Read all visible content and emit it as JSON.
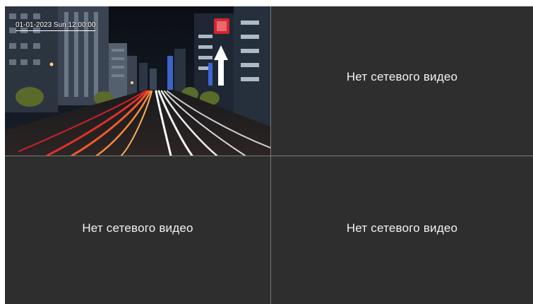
{
  "channel1": {
    "timestamp": "01-01-2023 Sun 12:00:00",
    "feed_icon": "night-city-traffic-camera-feed"
  },
  "channel2": {
    "message": "Нет сетевого видео"
  },
  "channel3": {
    "message": "Нет сетевого видео"
  },
  "channel4": {
    "message": "Нет сетевого видео"
  },
  "colors": {
    "tile_background": "#2e2e2e",
    "grid_divider": "#7a7a7a",
    "text": "#f2f2f2"
  }
}
